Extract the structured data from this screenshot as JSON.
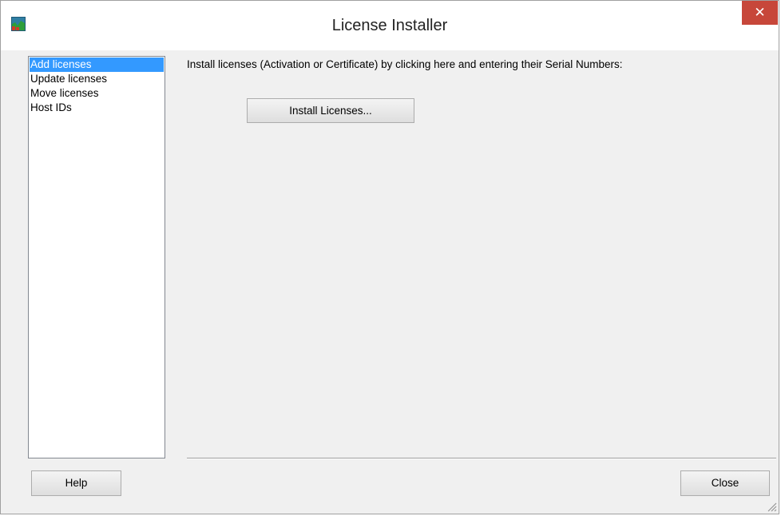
{
  "window": {
    "title": "License Installer",
    "close_glyph": "✕",
    "app_icon": "chart-app-icon"
  },
  "sidebar": {
    "items": [
      {
        "label": "Add licenses",
        "selected": true
      },
      {
        "label": "Update licenses",
        "selected": false
      },
      {
        "label": "Move licenses",
        "selected": false
      },
      {
        "label": "Host IDs",
        "selected": false
      }
    ]
  },
  "main": {
    "instruction": "Install licenses (Activation or Certificate) by clicking here and entering their Serial Numbers:",
    "install_button": "Install Licenses..."
  },
  "footer": {
    "help_button": "Help",
    "close_button": "Close"
  },
  "colors": {
    "selection": "#3399ff",
    "title_close": "#c7473a"
  }
}
